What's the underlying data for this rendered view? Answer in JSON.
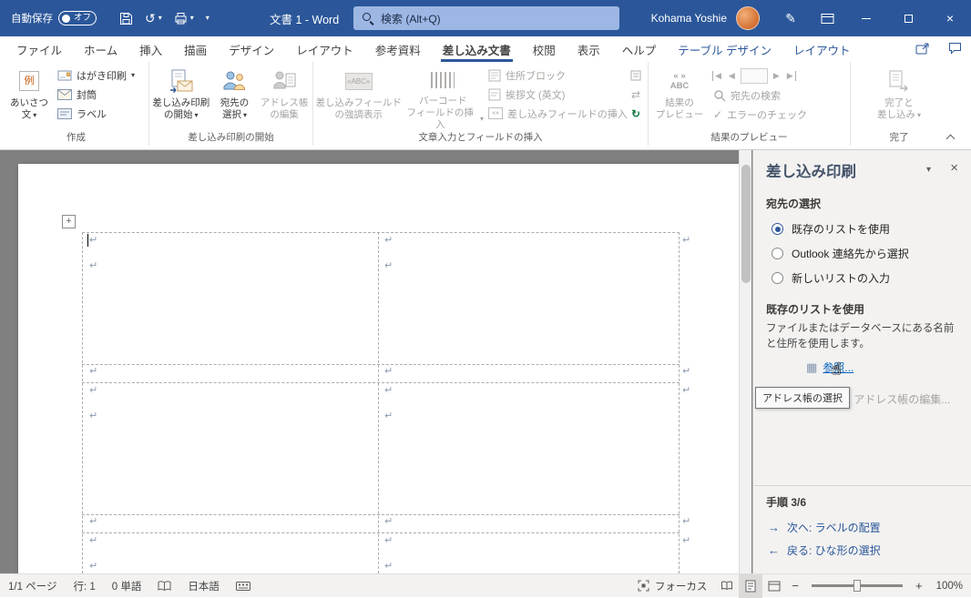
{
  "title_bar": {
    "autosave_label": "自動保存",
    "autosave_state": "オフ",
    "document_title": "文書 1 - Word",
    "search_placeholder": "検索 (Alt+Q)",
    "user_name": "Kohama Yoshie"
  },
  "ribbon_tabs": [
    {
      "label": "ファイル"
    },
    {
      "label": "ホーム"
    },
    {
      "label": "挿入"
    },
    {
      "label": "描画"
    },
    {
      "label": "デザイン"
    },
    {
      "label": "レイアウト"
    },
    {
      "label": "参考資料"
    },
    {
      "label": "差し込み文書",
      "active": true
    },
    {
      "label": "校閲"
    },
    {
      "label": "表示"
    },
    {
      "label": "ヘルプ"
    },
    {
      "label": "テーブル デザイン",
      "contextual": true
    },
    {
      "label": "レイアウト",
      "contextual": true
    }
  ],
  "ribbon": {
    "groups": [
      {
        "label": "作成"
      },
      {
        "label": "差し込み印刷の開始"
      },
      {
        "label": "文章入力とフィールドの挿入"
      },
      {
        "label": "結果のプレビュー"
      },
      {
        "label": "完了"
      }
    ],
    "buttons": {
      "greeting_l1": "あいさつ",
      "greeting_l2": "文",
      "greeting_icon_text": "例",
      "hagaki": "はがき印刷",
      "envelope": "封筒",
      "label": "ラベル",
      "start_merge_l1": "差し込み印刷",
      "start_merge_l2": "の開始",
      "select_recipients_l1": "宛先の",
      "select_recipients_l2": "選択",
      "edit_recipients_l1": "アドレス帳",
      "edit_recipients_l2": "の編集",
      "highlight_l1": "差し込みフィールド",
      "highlight_l2": "の強調表示",
      "barcode_l1": "バーコード",
      "barcode_l2": "フィールドの挿入",
      "address_block": "住所ブロック",
      "greeting_line": "挨拶文 (英文)",
      "insert_merge_field": "差し込みフィールドの挿入",
      "preview_l1": "結果の",
      "preview_l2": "プレビュー",
      "find_recipient": "宛先の検索",
      "check_errors": "エラーのチェック",
      "finish_l1": "完了と",
      "finish_l2": "差し込み"
    }
  },
  "task_pane": {
    "title": "差し込み印刷",
    "select_heading": "宛先の選択",
    "radio_options": [
      {
        "label": "既存のリストを使用",
        "selected": true
      },
      {
        "label": "Outlook 連絡先から選択",
        "selected": false
      },
      {
        "label": "新しいリストの入力",
        "selected": false
      }
    ],
    "existing_heading": "既存のリストを使用",
    "existing_desc_1": "ファイルまたはデータベースにある名前",
    "existing_desc_2": "と住所を使用します。",
    "browse_link": "参照...",
    "edit_address_link": "アドレス帳の編集...",
    "tooltip": "アドレス帳の選択",
    "step_label": "手順 3/6",
    "next_arrow": "→",
    "next_link": "次へ: ラベルの配置",
    "back_arrow": "←",
    "back_link": "戻る: ひな形の選択"
  },
  "status_bar": {
    "page_indicator": "1/1 ページ",
    "line_indicator": "行: 1",
    "word_count": "0 単語",
    "language": "日本語",
    "focus_label": "フォーカス",
    "zoom_value": "100%"
  },
  "document": {
    "paragraph_mark": "↵"
  },
  "icons": {
    "dropdown": "▾",
    "undo": "↺",
    "pen": "✎",
    "close": "×",
    "update_labels": "↻",
    "match_fields": "⇄",
    "check": "✓",
    "nav_prev": "◀",
    "nav_next": "▶",
    "guillemets": "« »",
    "abc": "ABC",
    "merge_field": "«ABC»",
    "table_glyph": "▦",
    "plus": "+",
    "minus": "−",
    "hand_cursor": "☝"
  },
  "colors": {
    "title_bar": "#2b579a",
    "accent": "#2b579a",
    "link_blue": "#0563c1",
    "disabled_gray": "#a6a4a2",
    "update_green": "#107c41"
  }
}
